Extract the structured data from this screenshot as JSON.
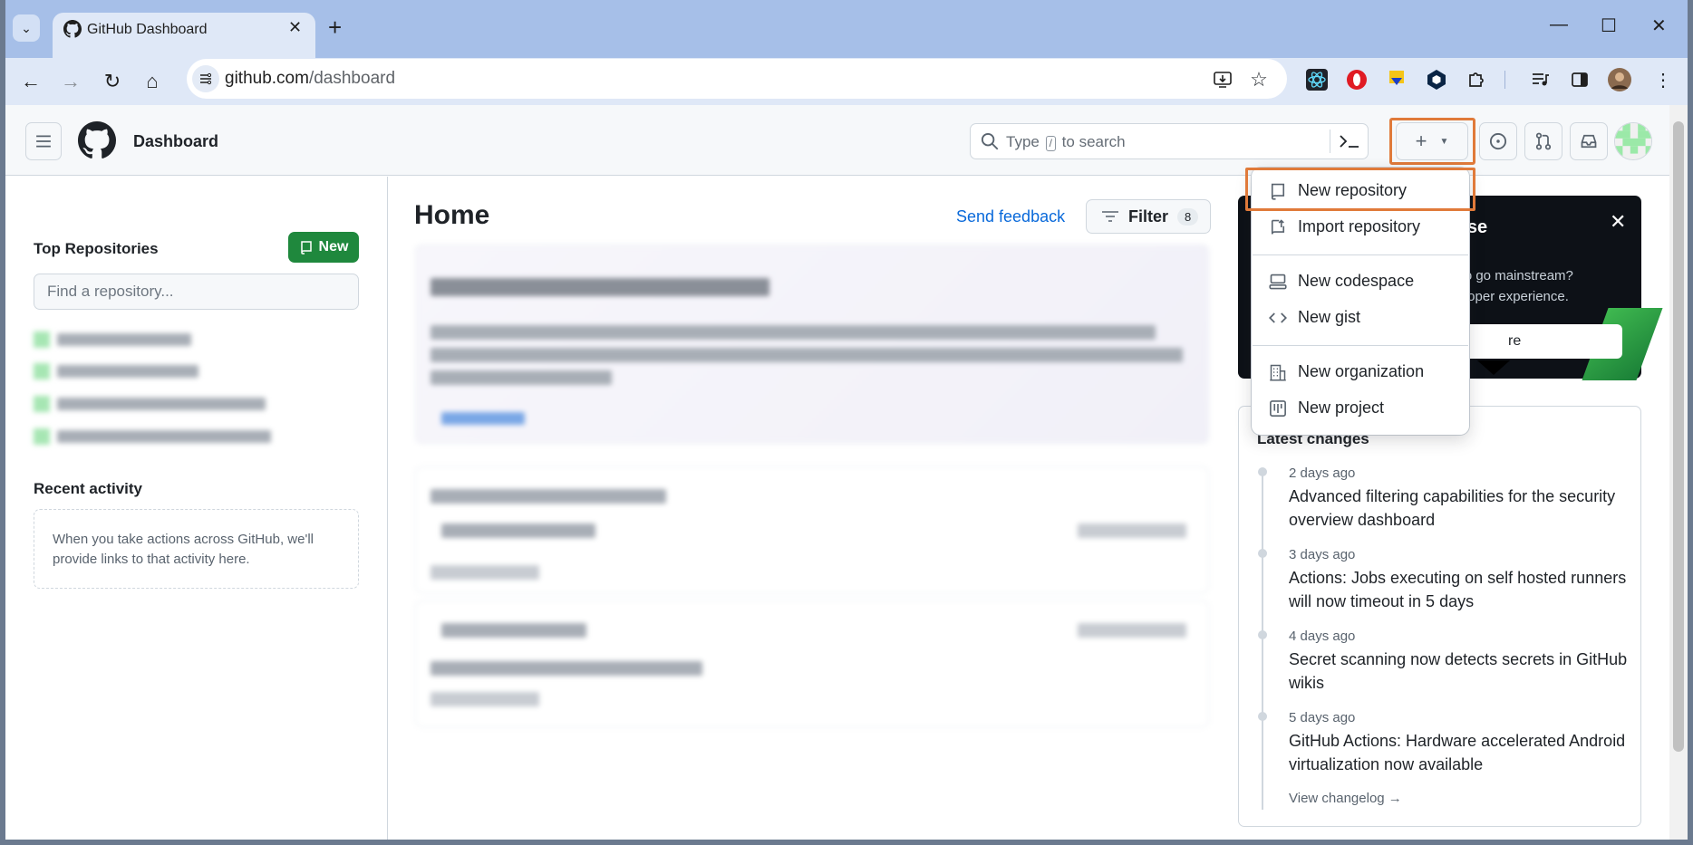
{
  "browser": {
    "tab_title": "GitHub Dashboard",
    "url_host": "github.com",
    "url_path": "/dashboard"
  },
  "header": {
    "context": "Dashboard",
    "search_prefix": "Type",
    "search_key": "/",
    "search_suffix": "to search",
    "create_label": "+"
  },
  "sidebar": {
    "top_repos_title": "Top Repositories",
    "new_button": "New",
    "find_placeholder": "Find a repository...",
    "recent_title": "Recent activity",
    "recent_empty": "When you take actions across GitHub, we'll provide links to that activity here."
  },
  "feed": {
    "title": "Home",
    "send_feedback": "Send feedback",
    "filter_label": "Filter",
    "filter_count": "8"
  },
  "create_menu": {
    "items": [
      {
        "label": "New repository",
        "icon": "repo-icon"
      },
      {
        "label": "Import repository",
        "icon": "repo-push-icon"
      },
      {
        "label": "New codespace",
        "icon": "codespaces-icon"
      },
      {
        "label": "New gist",
        "icon": "code-icon"
      },
      {
        "label": "New organization",
        "icon": "organization-icon"
      },
      {
        "label": "New project",
        "icon": "project-icon"
      }
    ]
  },
  "promo": {
    "title_fragment": "erse",
    "line1": "y to go mainstream?",
    "line2": "veloper experience.",
    "button_fragment": "re"
  },
  "changes": {
    "title": "Latest changes",
    "items": [
      {
        "date": "2 days ago",
        "text": "Advanced filtering capabilities for the security overview dashboard"
      },
      {
        "date": "3 days ago",
        "text": "Actions: Jobs executing on self hosted runners will now timeout in 5 days"
      },
      {
        "date": "4 days ago",
        "text": "Secret scanning now detects secrets in GitHub wikis"
      },
      {
        "date": "5 days ago",
        "text": "GitHub Actions: Hardware accelerated Android virtualization now available"
      }
    ],
    "changelog_link": "View changelog →"
  },
  "colors": {
    "accent_green": "#1f883d",
    "link_blue": "#0969da",
    "highlight_orange": "#e07a3a"
  }
}
